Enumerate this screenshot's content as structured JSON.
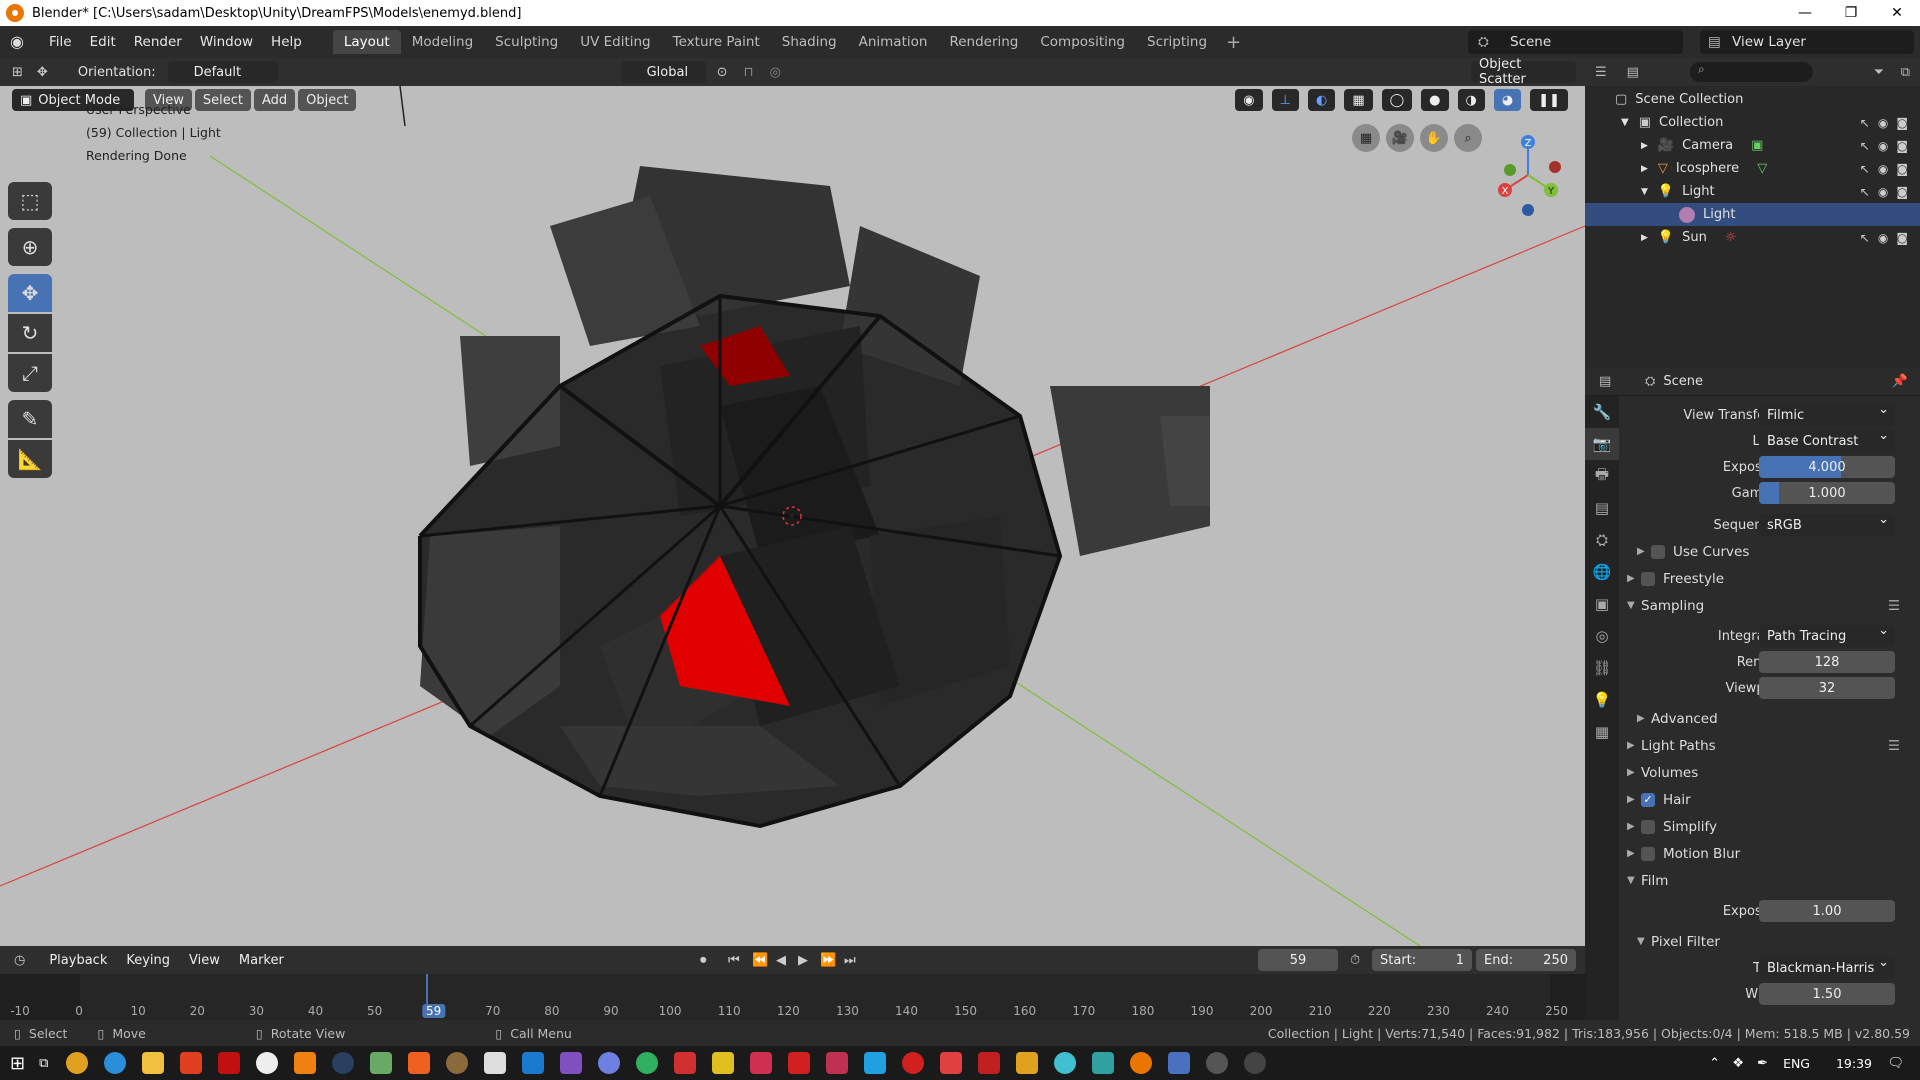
{
  "window": {
    "title": "Blender* [C:\\Users\\sadam\\Desktop\\Unity\\DreamFPS\\Models\\enemyd.blend]",
    "controls": [
      "—",
      "❐",
      "✕"
    ]
  },
  "topbar": {
    "menus": [
      "File",
      "Edit",
      "Render",
      "Window",
      "Help"
    ],
    "workspaces": [
      "Layout",
      "Modeling",
      "Sculpting",
      "UV Editing",
      "Texture Paint",
      "Shading",
      "Animation",
      "Rendering",
      "Compositing",
      "Scripting"
    ],
    "active_workspace": "Layout",
    "scene": "Scene",
    "view_layer": "View Layer"
  },
  "viewport": {
    "orientation_label": "Orientation:",
    "orientation_value": "Default",
    "transform_orientation": "Global",
    "object_scatter": "Object Scatter",
    "mode": "Object Mode",
    "menus": [
      "View",
      "Select",
      "Add",
      "Object"
    ],
    "overlay_lines": [
      "User Perspective",
      "(59) Collection | Light",
      "Rendering Done"
    ],
    "gizmo_axes": {
      "x": "X",
      "y": "Y",
      "z": "Z"
    },
    "colors": {
      "background": "#bdbdbd",
      "x_axis": "#d9433f",
      "y_axis": "#7fbf3a",
      "z_axis": "#3f7fe0",
      "highlight": "#ff1010"
    }
  },
  "outliner": {
    "root": "Scene Collection",
    "collection": "Collection",
    "items": [
      {
        "name": "Camera",
        "icon": "camera-icon"
      },
      {
        "name": "Icosphere",
        "icon": "mesh-icon"
      },
      {
        "name": "Light",
        "icon": "light-icon"
      },
      {
        "name": "Light",
        "icon": "light-data-icon",
        "selected": true
      },
      {
        "name": "Sun",
        "icon": "sun-icon"
      }
    ]
  },
  "properties": {
    "header": "Scene",
    "view_transform_label": "View Transform",
    "view_transform": "Filmic",
    "look_label": "Look",
    "look": "Base Contrast",
    "exposure_label": "Exposure",
    "exposure": "4.000",
    "exposure_fill": 0.6,
    "gamma_label": "Gamma",
    "gamma": "1.000",
    "gamma_fill": 0.15,
    "sequencer_label": "Sequencer",
    "sequencer": "sRGB",
    "use_curves": "Use Curves",
    "freestyle": "Freestyle",
    "sampling": "Sampling",
    "integrator_label": "Integrator",
    "integrator": "Path Tracing",
    "render_label": "Render",
    "render": "128",
    "viewport_label": "Viewport",
    "viewport": "32",
    "advanced": "Advanced",
    "light_paths": "Light Paths",
    "volumes": "Volumes",
    "hair": "Hair",
    "simplify": "Simplify",
    "motion_blur": "Motion Blur",
    "film": "Film",
    "film_exposure_label": "Exposure",
    "film_exposure": "1.00",
    "pixel_filter": "Pixel Filter",
    "type_label": "Type",
    "type": "Blackman-Harris",
    "width_label": "Width",
    "width": "1.50"
  },
  "timeline": {
    "menus": [
      "Playback",
      "Keying",
      "View",
      "Marker"
    ],
    "current_frame": "59",
    "start_label": "Start:",
    "start": "1",
    "end_label": "End:",
    "end": "250",
    "ticks": [
      "-10",
      "0",
      "10",
      "20",
      "30",
      "40",
      "50",
      "59",
      "70",
      "80",
      "90",
      "100",
      "110",
      "120",
      "130",
      "140",
      "150",
      "160",
      "170",
      "180",
      "190",
      "200",
      "210",
      "220",
      "230",
      "240",
      "250"
    ]
  },
  "statusbar": {
    "select": "Select",
    "move": "Move",
    "rotate": "Rotate View",
    "call_menu": "Call Menu",
    "stats": "Collection | Light | Verts:71,540 | Faces:91,982 | Tris:183,956 | Objects:0/4 | Mem: 518.5 MB | v2.80.59"
  },
  "taskbar": {
    "lang": "ENG",
    "time": "19:39"
  }
}
